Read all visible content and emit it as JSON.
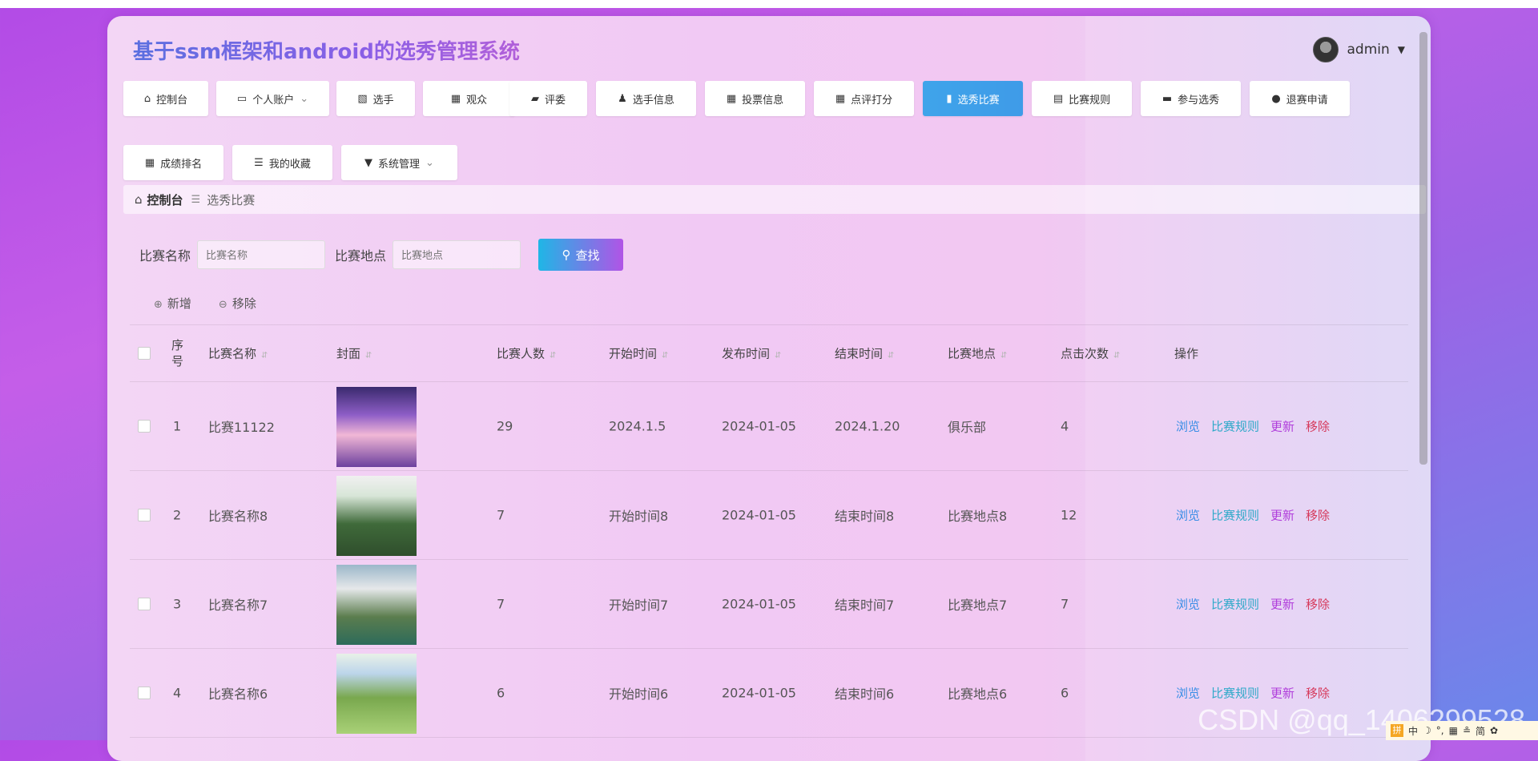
{
  "app": {
    "title": "基于ssm框架和android的选秀管理系统",
    "user": "admin"
  },
  "nav": [
    {
      "label": "控制台",
      "icon": "home-icon",
      "glyph": "⌂"
    },
    {
      "label": "个人账户",
      "icon": "account-icon",
      "glyph": "▭",
      "dropdown": "⌄"
    },
    {
      "label": "选手",
      "icon": "chart-icon",
      "glyph": "▧"
    },
    {
      "label": "观众",
      "icon": "grid-icon",
      "glyph": "▦"
    },
    {
      "label": "评委",
      "icon": "wallet-icon",
      "glyph": "▰"
    },
    {
      "label": "选手信息",
      "icon": "user-icon",
      "glyph": "♟"
    },
    {
      "label": "投票信息",
      "icon": "grid-icon",
      "glyph": "▦"
    },
    {
      "label": "点评打分",
      "icon": "grid-icon",
      "glyph": "▦"
    },
    {
      "label": "选秀比赛",
      "icon": "bar-chart-icon",
      "glyph": "▮"
    },
    {
      "label": "比赛规则",
      "icon": "briefcase-icon",
      "glyph": "▤"
    },
    {
      "label": "参与选秀",
      "icon": "ticket-icon",
      "glyph": "▬"
    },
    {
      "label": "退赛申请",
      "icon": "pin-icon",
      "glyph": "●"
    },
    {
      "label": "成绩排名",
      "icon": "grid-icon",
      "glyph": "▦"
    },
    {
      "label": "我的收藏",
      "icon": "sliders-icon",
      "glyph": "☰"
    },
    {
      "label": "系统管理",
      "icon": "system-icon",
      "glyph": "▼",
      "dropdown": "⌄"
    }
  ],
  "breadcrumb": {
    "home": "控制台",
    "separator": "☰",
    "current": "选秀比赛"
  },
  "search": {
    "name_label": "比赛名称",
    "name_placeholder": "比赛名称",
    "place_label": "比赛地点",
    "place_placeholder": "比赛地点",
    "button": "查找"
  },
  "actions": {
    "add": "新增",
    "remove": "移除"
  },
  "table": {
    "headers": [
      "序号",
      "比赛名称",
      "封面",
      "比赛人数",
      "开始时间",
      "发布时间",
      "结束时间",
      "比赛地点",
      "点击次数",
      "操作"
    ],
    "ops": {
      "view": "浏览",
      "rule": "比赛规则",
      "update": "更新",
      "del": "移除"
    },
    "rows": [
      {
        "no": "1",
        "name": "比赛11122",
        "count": "29",
        "start": "2024.1.5",
        "publish": "2024-01-05",
        "end": "2024.1.20",
        "place": "俱乐部",
        "clicks": "4"
      },
      {
        "no": "2",
        "name": "比赛名称8",
        "count": "7",
        "start": "开始时间8",
        "publish": "2024-01-05",
        "end": "结束时间8",
        "place": "比赛地点8",
        "clicks": "12"
      },
      {
        "no": "3",
        "name": "比赛名称7",
        "count": "7",
        "start": "开始时间7",
        "publish": "2024-01-05",
        "end": "结束时间7",
        "place": "比赛地点7",
        "clicks": "7"
      },
      {
        "no": "4",
        "name": "比赛名称6",
        "count": "6",
        "start": "开始时间6",
        "publish": "2024-01-05",
        "end": "结束时间6",
        "place": "比赛地点6",
        "clicks": "6"
      }
    ]
  },
  "watermark": "CSDN @qq_1406299528",
  "ime": {
    "items": [
      "拼",
      "中",
      "☽",
      "°,",
      "▦",
      "≗",
      "简",
      "✿"
    ]
  },
  "colors": {
    "accent": "#3fa4ea",
    "brand_gradient_start": "#1fb6e6",
    "brand_gradient_end": "#b154e6"
  }
}
